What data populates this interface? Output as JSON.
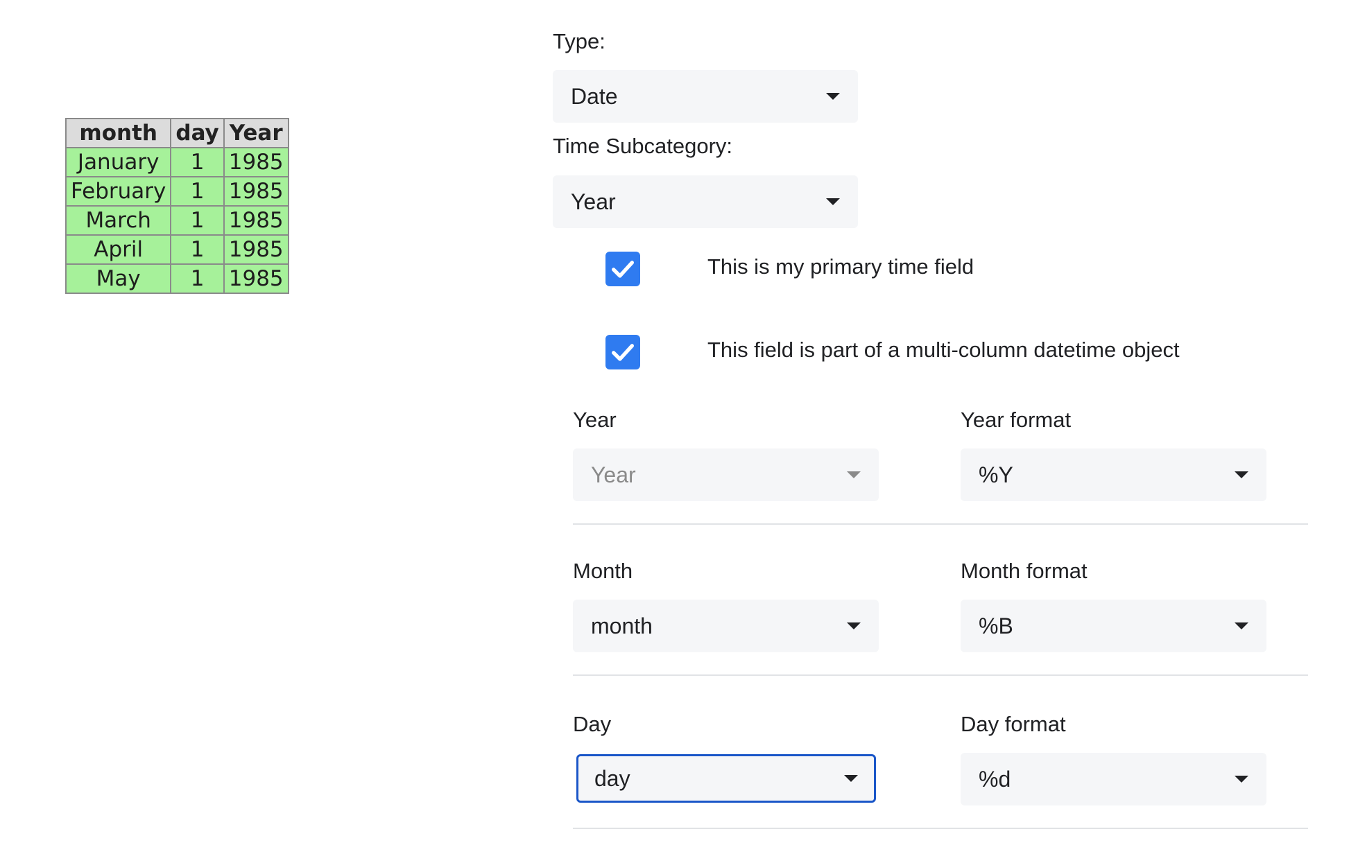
{
  "table": {
    "headers": [
      "month",
      "day",
      "Year"
    ],
    "rows": [
      [
        "January",
        "1",
        "1985"
      ],
      [
        "February",
        "1",
        "1985"
      ],
      [
        "March",
        "1",
        "1985"
      ],
      [
        "April",
        "1",
        "1985"
      ],
      [
        "May",
        "1",
        "1985"
      ]
    ]
  },
  "form": {
    "type_label": "Type:",
    "type_value": "Date",
    "subcategory_label": "Time Subcategory:",
    "subcategory_value": "Year",
    "primary_checkbox": {
      "checked": true,
      "label": "This is my primary time field"
    },
    "multicolumn_checkbox": {
      "checked": true,
      "label": "This field is part of a multi-column datetime object"
    },
    "parts": {
      "year": {
        "label": "Year",
        "value": "Year",
        "format_label": "Year format",
        "format_value": "%Y"
      },
      "month": {
        "label": "Month",
        "value": "month",
        "format_label": "Month format",
        "format_value": "%B"
      },
      "day": {
        "label": "Day",
        "value": "day",
        "format_label": "Day format",
        "format_value": "%d"
      }
    }
  },
  "colors": {
    "accent": "#2f7bf0",
    "focus_border": "#1a56c8",
    "table_cell_bg": "#a6f19a",
    "table_header_bg": "#dcdcdc"
  },
  "icons": {
    "dropdown": "caret-down-icon",
    "checkbox": "checkmark-icon"
  }
}
